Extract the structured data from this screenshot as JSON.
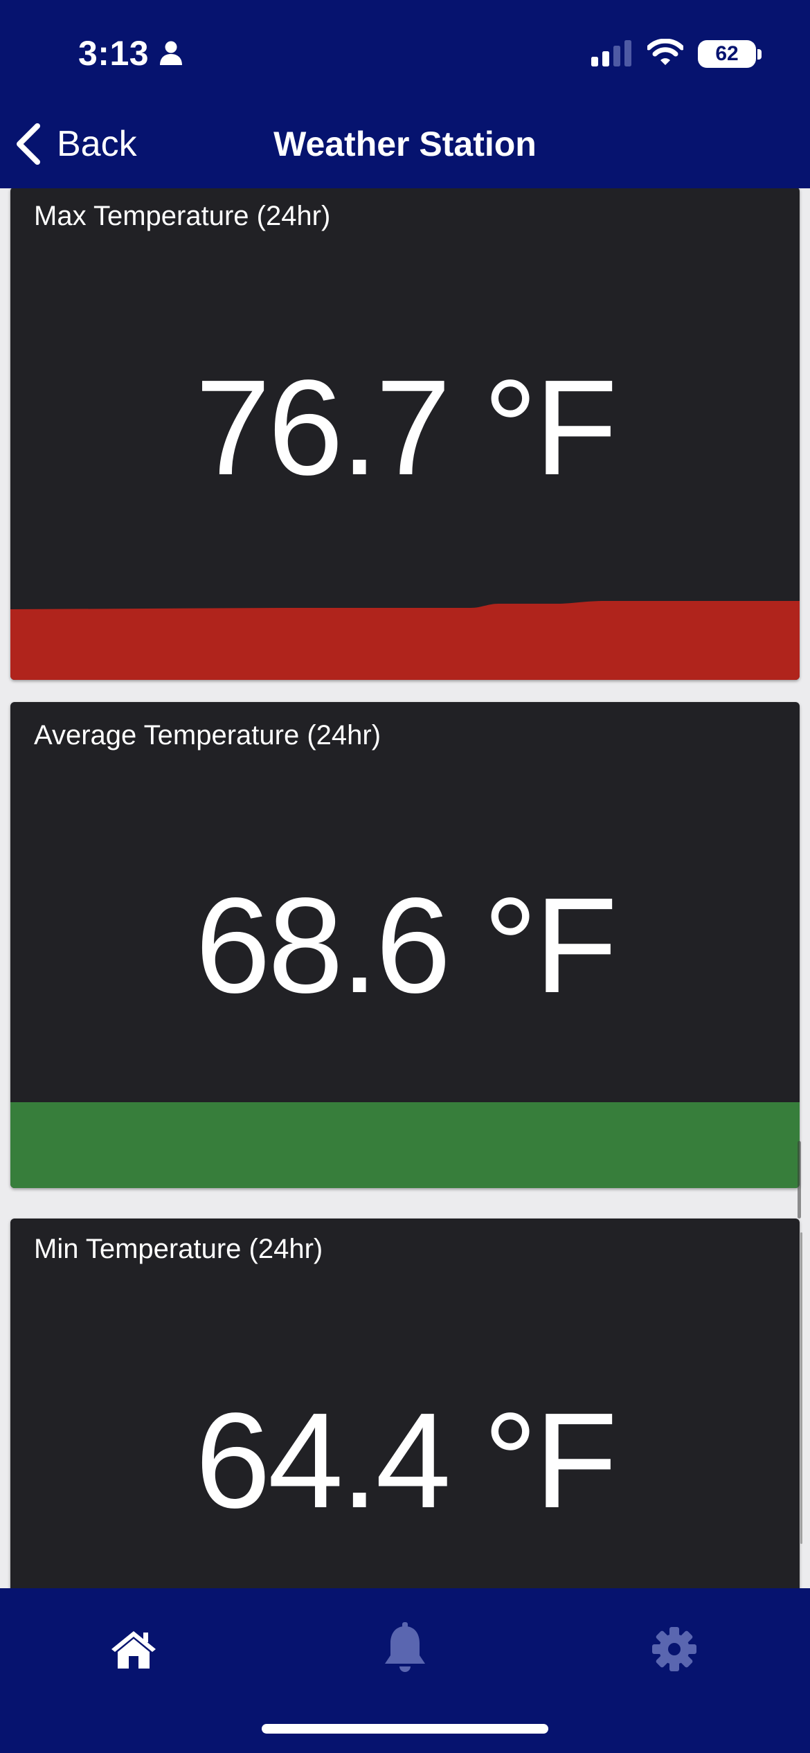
{
  "status_bar": {
    "time": "3:13",
    "battery": "62",
    "icons": [
      "person-icon",
      "signal-icon",
      "wifi-icon",
      "battery-icon"
    ]
  },
  "nav": {
    "back_label": "Back",
    "title": "Weather Station"
  },
  "cards": [
    {
      "title": "Max Temperature (24hr)",
      "value": "76.7 °F",
      "bar_color": "#b0241c"
    },
    {
      "title": "Average Temperature (24hr)",
      "value": "68.6 °F",
      "bar_color": "#377e3b"
    },
    {
      "title": "Min Temperature (24hr)",
      "value": "64.4 °F"
    }
  ],
  "tabbar": {
    "tabs": [
      {
        "icon": "home-icon",
        "active": true
      },
      {
        "icon": "bell-icon",
        "active": false
      },
      {
        "icon": "gear-icon",
        "active": false
      }
    ]
  },
  "colors": {
    "header": "#06136f",
    "card": "#212125",
    "inactive_tab_icon": "#5a66b0"
  }
}
